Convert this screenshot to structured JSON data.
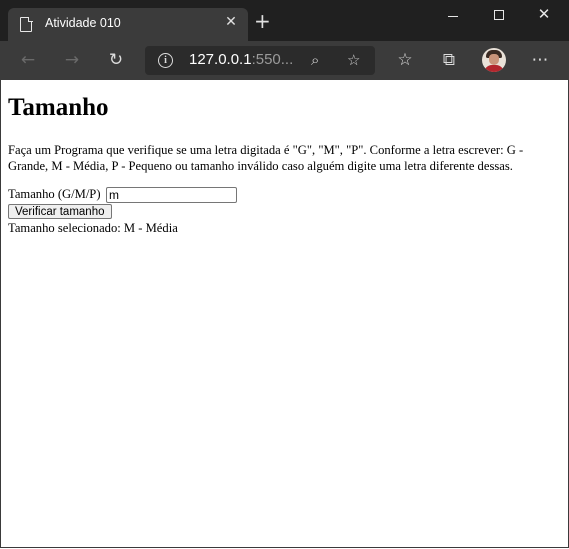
{
  "browser": {
    "tab_title": "Atividade 010",
    "tab_close": "✕",
    "new_tab": "+",
    "url_host": "127.0.0.1",
    "url_rest": ":550...",
    "close_glyph": "✕"
  },
  "page": {
    "heading": "Tamanho",
    "description": "Faça um Programa que verifique se uma letra digitada é \"G\", \"M\", \"P\". Conforme a letra escrever: G - Grande, M - Média, P - Pequeno ou tamanho inválido caso alguém digite uma letra diferente dessas.",
    "size_label": "Tamanho (G/M/P)",
    "size_value": "m",
    "verify_button": "Verificar tamanho",
    "result_text": "Tamanho selecionado: M - Média"
  }
}
